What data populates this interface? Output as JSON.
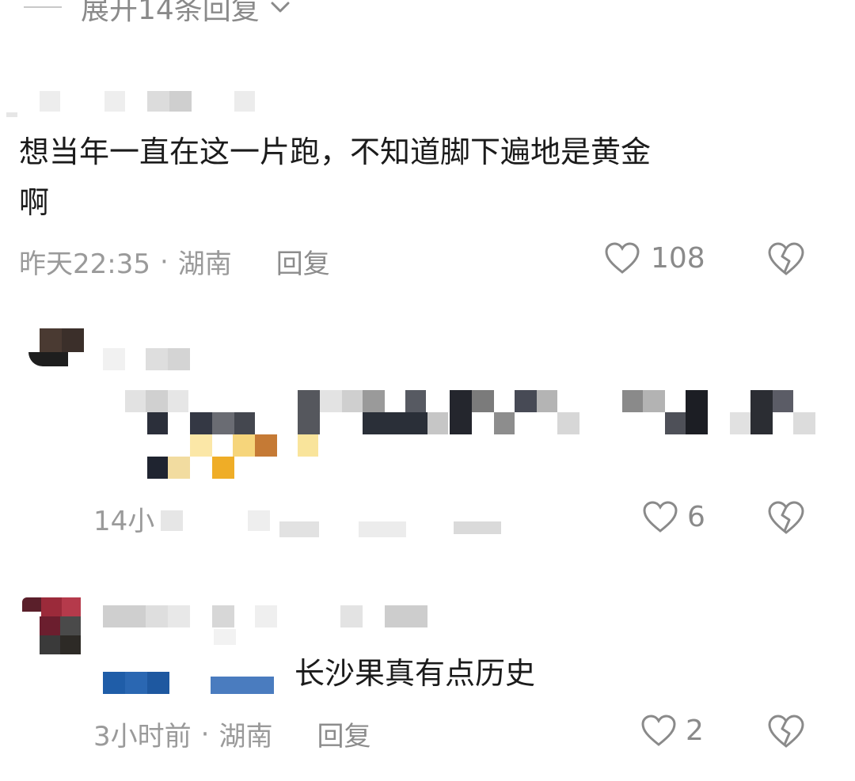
{
  "thread": {
    "expand_label": "展开14条回复"
  },
  "comments": [
    {
      "text": "想当年一直在这一片跑，不知道脚下遍地是黄金啊",
      "text_line1": "想当年一直在这一片跑，不知道脚下遍地是黄金",
      "text_line2": "啊",
      "time": "昨天22:35",
      "location": "湖南",
      "reply_label": "回复",
      "likes": "108"
    },
    {
      "time_partial": "14小",
      "likes": "6"
    },
    {
      "text": "长沙果真有点历史",
      "time": "3小时前",
      "location": "湖南",
      "reply_label": "回复",
      "likes": "2"
    }
  ],
  "separator": "·",
  "icons": {
    "expand": "chevron-down-icon",
    "like": "heart-outline-icon",
    "dislike": "broken-heart-icon"
  },
  "colors": {
    "meta_text": "#9a9a9a",
    "body_text": "#1b1b1b",
    "icon": "#8a8a8a"
  }
}
